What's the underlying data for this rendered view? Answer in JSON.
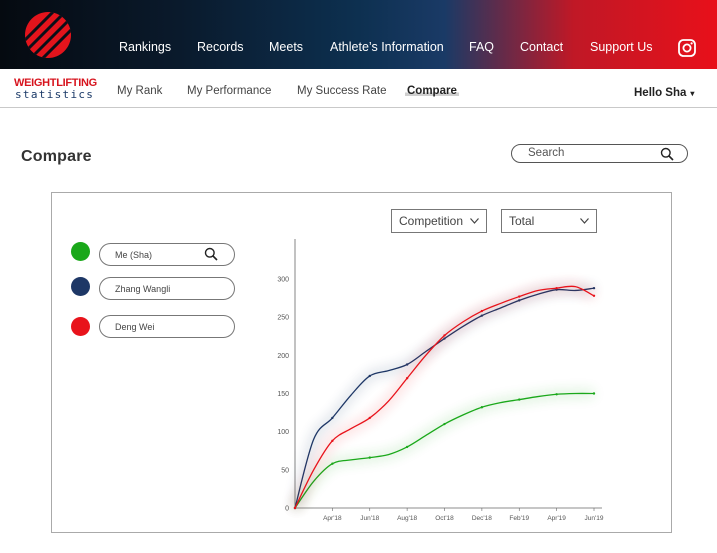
{
  "topnav": {
    "items": [
      {
        "label": "Rankings"
      },
      {
        "label": "Records"
      },
      {
        "label": "Meets"
      },
      {
        "label": "Athlete’s Information"
      },
      {
        "label": "FAQ"
      },
      {
        "label": "Contact"
      },
      {
        "label": "Support Us"
      }
    ],
    "social_icon": "instagram-icon"
  },
  "brand": {
    "line1": "WEIGHTLIFTING",
    "line2": "statistics"
  },
  "subnav": {
    "items": [
      {
        "label": "My Rank"
      },
      {
        "label": "My Performance"
      },
      {
        "label": "My Success Rate"
      },
      {
        "label": "Compare",
        "active": true
      }
    ],
    "user_greeting": "Hello Sha",
    "user_caret": "▾"
  },
  "page": {
    "title": "Compare"
  },
  "search": {
    "placeholder": "Search"
  },
  "filters": {
    "event": "Competition",
    "metric": "Total"
  },
  "athletes": [
    {
      "name": "Me (Sha)",
      "color": "#1aa81a",
      "has_search_icon": true
    },
    {
      "name": "Zhang Wangli",
      "color": "#1e3766"
    },
    {
      "name": "Deng Wei",
      "color": "#e8131b"
    }
  ],
  "colors": {
    "accent_red": "#d7141e",
    "brand_navy": "#1b3a68"
  },
  "chart_data": {
    "type": "line",
    "x_tick_labels": [
      "Apr'18",
      "Jun'18",
      "Aug'18",
      "Oct'18",
      "Dec'18",
      "Feb'19",
      "Apr'19",
      "Jun'19"
    ],
    "x": [
      "Feb'18",
      "Mar'18",
      "Apr'18",
      "May'18",
      "Jun'18",
      "Jul'18",
      "Aug'18",
      "Sep'18",
      "Oct'18",
      "Nov'18",
      "Dec'18",
      "Jan'19",
      "Feb'19",
      "Mar'19",
      "Apr'19",
      "May'19",
      "Jun'19"
    ],
    "ylim": [
      0,
      300
    ],
    "yticks": [
      0,
      50,
      100,
      150,
      200,
      250,
      300
    ],
    "grid": false,
    "series": [
      {
        "name": "Me (Sha)",
        "color": "#1aa81a",
        "values": [
          0,
          35,
          58,
          63,
          66,
          70,
          80,
          95,
          110,
          122,
          132,
          138,
          142,
          146,
          149,
          150,
          150
        ]
      },
      {
        "name": "Zhang Wangli",
        "color": "#1e3766",
        "values": [
          0,
          90,
          118,
          148,
          173,
          180,
          188,
          205,
          222,
          238,
          252,
          262,
          272,
          280,
          286,
          285,
          288
        ]
      },
      {
        "name": "Deng Wei",
        "color": "#e8131b",
        "values": [
          0,
          50,
          88,
          104,
          118,
          140,
          170,
          200,
          226,
          244,
          258,
          268,
          277,
          285,
          288,
          290,
          278
        ]
      }
    ]
  }
}
